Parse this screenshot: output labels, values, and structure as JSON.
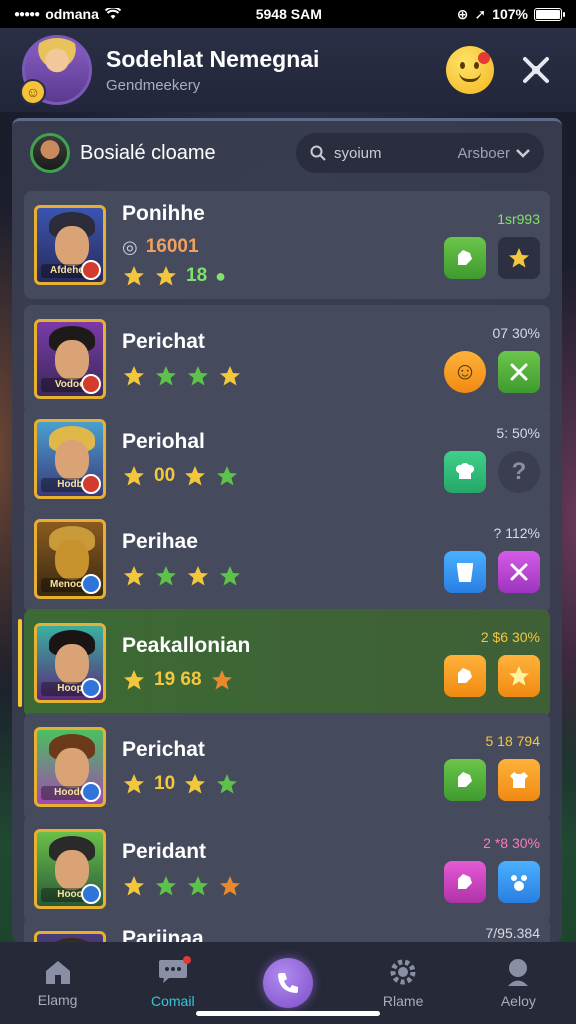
{
  "status_bar": {
    "carrier": "odmana",
    "time": "5948 SAM",
    "battery": "107%"
  },
  "header": {
    "title": "Sodehlat Nemegnai",
    "subtitle": "Gendmeekery"
  },
  "panel": {
    "title": "Bosialé cloame",
    "search_placeholder": "syoium",
    "sort_label": "Arsboer"
  },
  "rows": [
    {
      "name": "Ponihhe",
      "meta_text": "16001",
      "meta_num": "18",
      "stat": "1sr993",
      "stars": 3,
      "portrait_label": "Afdeheh",
      "active": false
    },
    {
      "name": "Perichat",
      "meta_text": "",
      "meta_num": "",
      "stat": "07 30%",
      "stars": 4,
      "portrait_label": "Vodoo",
      "active": false
    },
    {
      "name": "Periohal",
      "meta_text": "",
      "meta_num": "00",
      "stat": "5: 50%",
      "stars": 3,
      "portrait_label": "Hodb",
      "active": false
    },
    {
      "name": "Perihae",
      "meta_text": "",
      "meta_num": "",
      "stat": "? 112%",
      "stars": 4,
      "portrait_label": "Menociv",
      "active": false
    },
    {
      "name": "Peakallonian",
      "meta_text": "",
      "meta_num": "19 68",
      "stat": "2 $6 30%",
      "stars": 2,
      "portrait_label": "Hoop",
      "active": true
    },
    {
      "name": "Perichat",
      "meta_text": "",
      "meta_num": "10",
      "stat": "5 18 794",
      "stars": 3,
      "portrait_label": "Hoodo",
      "active": false
    },
    {
      "name": "Peridant",
      "meta_text": "",
      "meta_num": "",
      "stat": "2 *8 30%",
      "stars": 4,
      "portrait_label": "Hooo",
      "active": false
    },
    {
      "name": "Pariinaa",
      "meta_text": "",
      "meta_num": "",
      "stat": "7/95.384",
      "stars": 0,
      "portrait_label": "",
      "active": false
    }
  ],
  "nav": {
    "items": [
      {
        "label": "Elamg",
        "icon": "home-icon"
      },
      {
        "label": "Comail",
        "icon": "chat-icon"
      },
      {
        "label": "",
        "icon": "phone-icon"
      },
      {
        "label": "Rlame",
        "icon": "gear-icon"
      },
      {
        "label": "Aeloy",
        "icon": "profile-icon"
      }
    ]
  },
  "colors": {
    "accent": "#39c6d6",
    "active_row": "#3c6a34",
    "star": "#f3c73b"
  }
}
